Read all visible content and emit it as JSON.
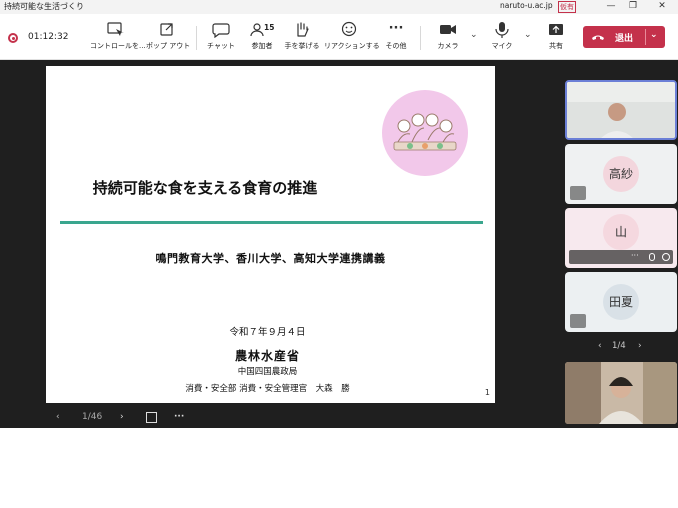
{
  "window": {
    "title": "持続可能な生活づくり",
    "domain": "naruto-u.ac.jp",
    "badge": "仮有",
    "minimize": "—",
    "restore": "❐",
    "close": "✕"
  },
  "toolbar": {
    "timer": "01:12:32",
    "controls_label": "コントロールを...",
    "popout_label": "ポップ アウト",
    "chat_label": "チャット",
    "participants_label": "参加者",
    "participants_count": "15",
    "raise_hand_label": "手を挙げる",
    "reactions_label": "リアクションする",
    "more_label": "その他",
    "camera_label": "カメラ",
    "mic_label": "マイク",
    "share_label": "共有",
    "leave_label": "退出",
    "more_icon": "···",
    "chevron": "⌄"
  },
  "slide": {
    "title": "持続可能な食を支える食育の推進",
    "subtitle": "鳴門教育大学、香川大学、高知大学連携講義",
    "date": "令和７年９月４日",
    "org": "農林水産省",
    "bureau": "中国四国農政局",
    "person": "消費・安全部 消費・安全管理官　大森　勝",
    "page_number": "1"
  },
  "slide_nav": {
    "prev": "‹",
    "position": "1/46",
    "next": "›",
    "more": "···"
  },
  "participants": {
    "tiles": [
      {
        "name": "高紗",
        "color": "#f3d6dd",
        "bg": "#eff1f2"
      },
      {
        "name": "山",
        "color": "#f5d8df",
        "bg": "#f7e9ee"
      },
      {
        "name": "田夏",
        "color": "#d9e1e7",
        "bg": "#ecf0f2"
      }
    ],
    "tile_more": "···",
    "nav_prev": "‹",
    "page": "1/4",
    "nav_next": "›"
  },
  "colors": {
    "leave": "#c4314b",
    "accent_line": "#3aa68e",
    "active_border": "#6b7fd6",
    "illustration_circle": "#f2c8ea"
  }
}
